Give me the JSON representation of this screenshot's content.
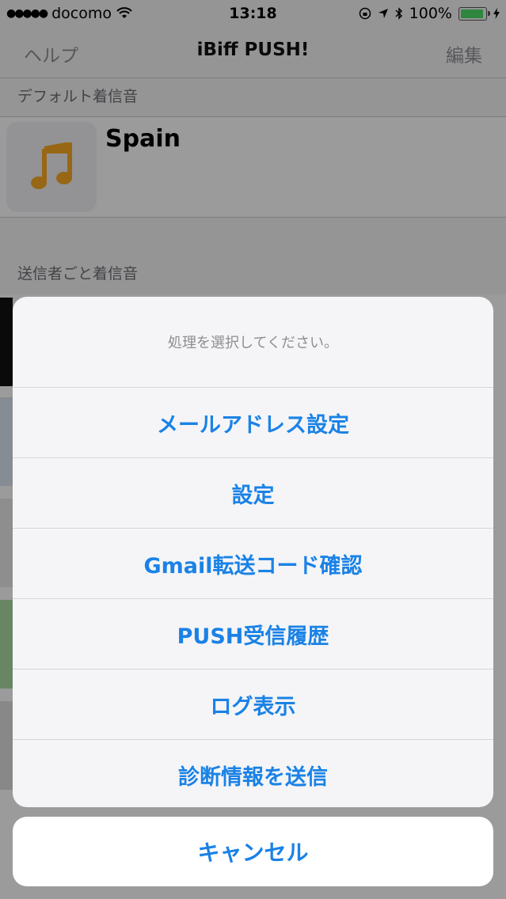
{
  "status_bar": {
    "carrier": "docomo",
    "time": "13:18",
    "battery": "100%",
    "signal_icon": "signal-dots-icon",
    "wifi_icon": "wifi-icon",
    "battery_level": 1.0
  },
  "navbar": {
    "left": "ヘルプ",
    "title": "iBiff PUSH!",
    "right": "編集"
  },
  "sections": {
    "default_header": "デフォルト着信音",
    "default_sound": "Spain",
    "per_sender_header": "送信者ごと着信音"
  },
  "action_sheet": {
    "message": "処理を選択してください。",
    "items": [
      "メールアドレス設定",
      "設定",
      "Gmail転送コード確認",
      "PUSH受信履歴",
      "ログ表示",
      "診断情報を送信"
    ],
    "cancel": "キャンセル"
  },
  "colors": {
    "action_blue": "#1a82e6",
    "music_icon": "#f5a623",
    "battery_green": "#4cd964"
  }
}
